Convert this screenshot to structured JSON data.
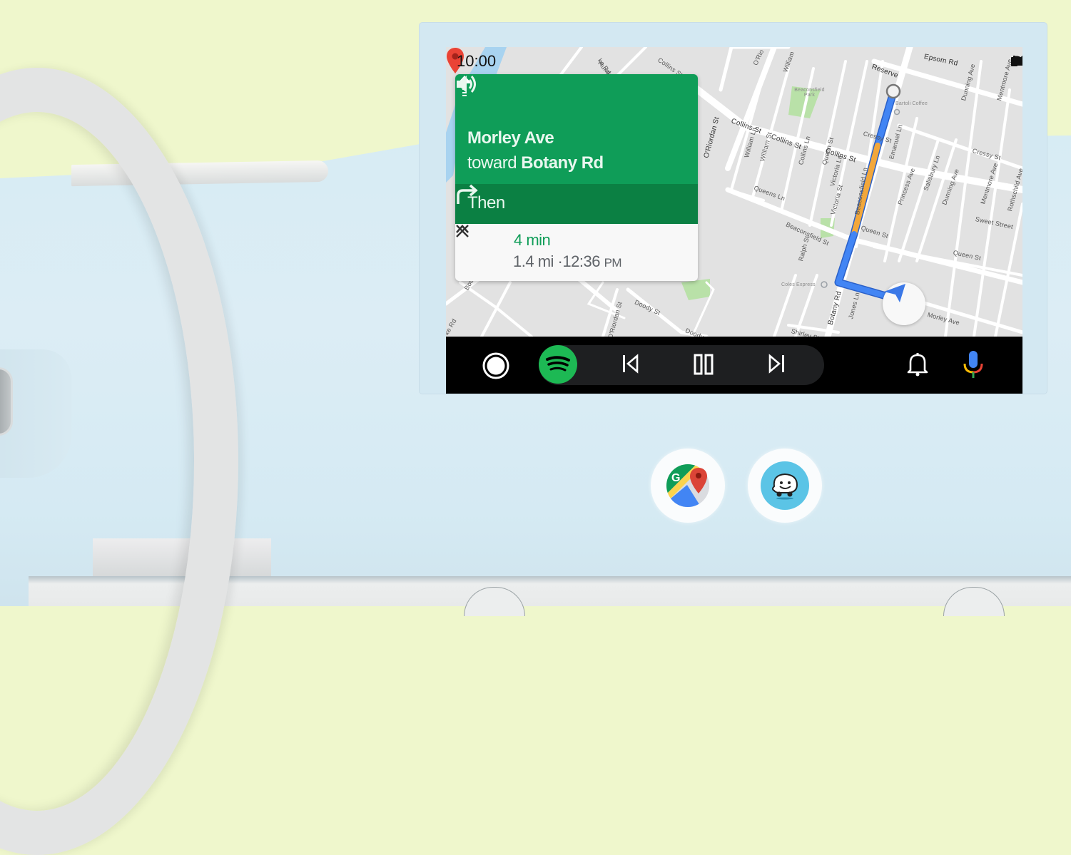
{
  "status_bar": {
    "time": "10:00",
    "icons": [
      "wifi-icon",
      "cell-signal-icon",
      "battery-icon"
    ]
  },
  "navigation": {
    "maneuver_icon": "straight-arrow-icon",
    "street": "Morley Ave",
    "toward_prefix": "toward",
    "toward_street": "Botany Rd",
    "then_label": "Then",
    "then_icon": "turn-right-icon",
    "eta": "4 min",
    "distance": "1.4 mi",
    "separator": "·",
    "arrival_time": "12:36",
    "arrival_ampm": "PM",
    "colors": {
      "primary_green": "#0f9d58",
      "dark_green": "#0b8043",
      "route_blue": "#4285f4",
      "route_traffic_orange": "#f2a73b",
      "pin_red": "#ea4335"
    }
  },
  "map": {
    "street_labels": [
      {
        "text": "Epsom Rd",
        "bold": true
      },
      {
        "text": "Reserve",
        "bold": true
      },
      {
        "text": "Collins St",
        "bold": true
      },
      {
        "text": "Collins St",
        "bold": true
      },
      {
        "text": "Collins St",
        "bold": true
      },
      {
        "text": "Collins St",
        "bold": false
      },
      {
        "text": "Huntley",
        "bold": false
      },
      {
        "text": "O'Riordan St",
        "bold": true
      },
      {
        "text": "O'Riordan St",
        "bold": false
      },
      {
        "text": "O'Rio",
        "bold": false
      },
      {
        "text": "William Ln",
        "bold": false
      },
      {
        "text": "William St",
        "bold": false
      },
      {
        "text": "William",
        "bold": false
      },
      {
        "text": "Collins Ln",
        "bold": false
      },
      {
        "text": "Queen St",
        "bold": false
      },
      {
        "text": "Queens Ln",
        "bold": false
      },
      {
        "text": "Victoria Ln",
        "bold": false
      },
      {
        "text": "Victoria St",
        "bold": false
      },
      {
        "text": "Beaconsfield Ln",
        "bold": false
      },
      {
        "text": "Beaconsfield St",
        "bold": false
      },
      {
        "text": "Emanuel Ln",
        "bold": false
      },
      {
        "text": "Cressy St",
        "bold": false
      },
      {
        "text": "Cressy St",
        "bold": false
      },
      {
        "text": "Princess Ave",
        "bold": false
      },
      {
        "text": "Salisbury Ln",
        "bold": false
      },
      {
        "text": "Dunning Ave",
        "bold": false
      },
      {
        "text": "Mentmore Ave",
        "bold": false
      },
      {
        "text": "Sweet Street",
        "bold": false
      },
      {
        "text": "Rothschild Ave",
        "bold": false
      },
      {
        "text": "Queen St",
        "bold": false
      },
      {
        "text": "Queen St",
        "bold": false
      },
      {
        "text": "Ralph St",
        "bold": false
      },
      {
        "text": "Botany Rd",
        "bold": true
      },
      {
        "text": "Jones Ln",
        "bold": false
      },
      {
        "text": "Shirley St",
        "bold": false
      },
      {
        "text": "Morley Ave",
        "bold": false
      },
      {
        "text": "Doody St",
        "bold": false
      },
      {
        "text": "Doody St",
        "bold": false
      },
      {
        "text": "Bourke",
        "bold": false
      },
      {
        "text": "ke Rd",
        "bold": false
      },
      {
        "text": "ke Rd",
        "bold": false
      },
      {
        "text": "Dunning Ave",
        "bold": false
      },
      {
        "text": "Mentmore Ave",
        "bold": false
      }
    ],
    "pois": [
      {
        "text": "Beaconsfield Park"
      },
      {
        "text": "Bartoli Coffee"
      },
      {
        "text": "Coles Express"
      }
    ]
  },
  "dock": {
    "home_icon": "home-circle-icon",
    "app_icon": "spotify-icon",
    "controls": [
      "skip-previous-icon",
      "pause-icon",
      "skip-next-icon"
    ],
    "notification_icon": "bell-icon",
    "voice_icon": "microphone-icon"
  },
  "apps_below": [
    {
      "name": "Google Maps",
      "icon": "google-maps-icon"
    },
    {
      "name": "Waze",
      "icon": "waze-icon"
    }
  ]
}
